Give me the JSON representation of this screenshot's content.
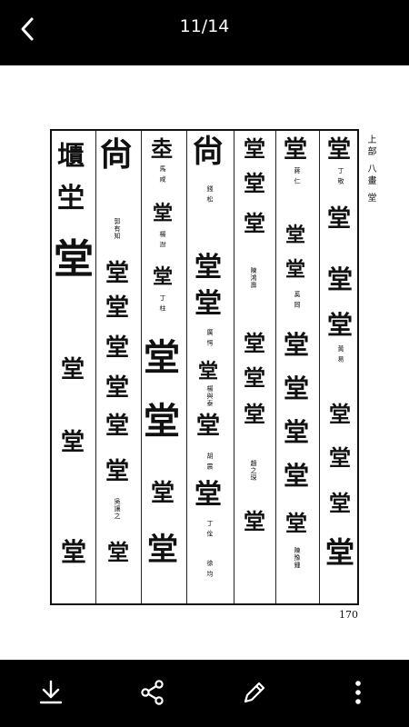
{
  "header": {
    "page_indicator": "11/14"
  },
  "document": {
    "heading": "上部 八畫 堂",
    "page_number": "170",
    "columns": [
      {
        "glyphs": [
          "㙺",
          "坣",
          "堂",
          "堂",
          "堂",
          "堂"
        ],
        "notes": []
      },
      {
        "glyphs": [
          "尙",
          "堂",
          "堂",
          "堂",
          "堂",
          "堂",
          "堂",
          "堂"
        ],
        "notes": [
          "郭有知",
          "吳讓之"
        ]
      },
      {
        "glyphs": [
          "坴",
          "堂",
          "堂",
          "堂",
          "堂",
          "堂",
          "堂"
        ],
        "notes": [
          "馬 咸",
          "楊 澍",
          "丁 柱"
        ]
      },
      {
        "glyphs": [
          "尙",
          "堂",
          "堂",
          "堂",
          "堂",
          "堂"
        ],
        "notes": [
          "錢 松",
          "厲 愕",
          "楊與泰",
          "胡 震",
          "丁 佺",
          "徐 均"
        ]
      },
      {
        "glyphs": [
          "堂",
          "堂",
          "堂",
          "堂",
          "堂",
          "堂",
          "堂"
        ],
        "notes": [
          "陳鴻壽",
          "趙之琛"
        ]
      },
      {
        "glyphs": [
          "堂",
          "堂",
          "堂",
          "堂",
          "堂",
          "堂",
          "堂",
          "堂"
        ],
        "notes": [
          "蔣 仁",
          "奚 岡",
          "陳豫鍾"
        ]
      },
      {
        "glyphs": [
          "堂",
          "堂",
          "堂",
          "堂",
          "堂",
          "堂",
          "堂",
          "堂"
        ],
        "notes": [
          "丁 敬",
          "黃 易"
        ]
      }
    ]
  },
  "toolbar": {
    "download": "download",
    "share": "share",
    "edit": "edit",
    "more": "more"
  }
}
